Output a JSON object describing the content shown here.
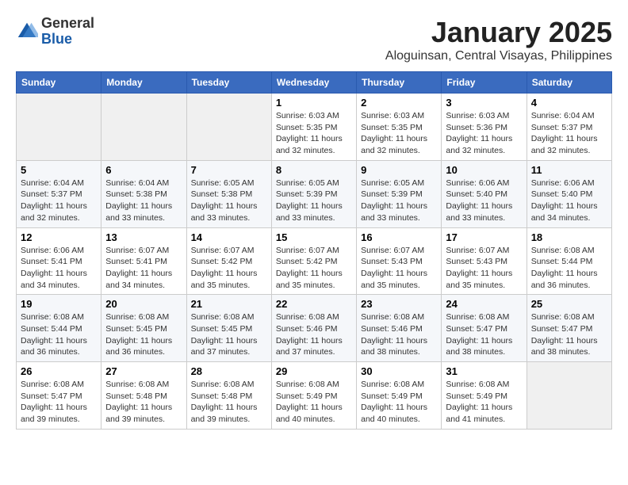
{
  "header": {
    "logo_general": "General",
    "logo_blue": "Blue",
    "month_title": "January 2025",
    "location": "Aloguinsan, Central Visayas, Philippines"
  },
  "weekdays": [
    "Sunday",
    "Monday",
    "Tuesday",
    "Wednesday",
    "Thursday",
    "Friday",
    "Saturday"
  ],
  "weeks": [
    [
      {
        "day": "",
        "info": ""
      },
      {
        "day": "",
        "info": ""
      },
      {
        "day": "",
        "info": ""
      },
      {
        "day": "1",
        "info": "Sunrise: 6:03 AM\nSunset: 5:35 PM\nDaylight: 11 hours and 32 minutes."
      },
      {
        "day": "2",
        "info": "Sunrise: 6:03 AM\nSunset: 5:35 PM\nDaylight: 11 hours and 32 minutes."
      },
      {
        "day": "3",
        "info": "Sunrise: 6:03 AM\nSunset: 5:36 PM\nDaylight: 11 hours and 32 minutes."
      },
      {
        "day": "4",
        "info": "Sunrise: 6:04 AM\nSunset: 5:37 PM\nDaylight: 11 hours and 32 minutes."
      }
    ],
    [
      {
        "day": "5",
        "info": "Sunrise: 6:04 AM\nSunset: 5:37 PM\nDaylight: 11 hours and 32 minutes."
      },
      {
        "day": "6",
        "info": "Sunrise: 6:04 AM\nSunset: 5:38 PM\nDaylight: 11 hours and 33 minutes."
      },
      {
        "day": "7",
        "info": "Sunrise: 6:05 AM\nSunset: 5:38 PM\nDaylight: 11 hours and 33 minutes."
      },
      {
        "day": "8",
        "info": "Sunrise: 6:05 AM\nSunset: 5:39 PM\nDaylight: 11 hours and 33 minutes."
      },
      {
        "day": "9",
        "info": "Sunrise: 6:05 AM\nSunset: 5:39 PM\nDaylight: 11 hours and 33 minutes."
      },
      {
        "day": "10",
        "info": "Sunrise: 6:06 AM\nSunset: 5:40 PM\nDaylight: 11 hours and 33 minutes."
      },
      {
        "day": "11",
        "info": "Sunrise: 6:06 AM\nSunset: 5:40 PM\nDaylight: 11 hours and 34 minutes."
      }
    ],
    [
      {
        "day": "12",
        "info": "Sunrise: 6:06 AM\nSunset: 5:41 PM\nDaylight: 11 hours and 34 minutes."
      },
      {
        "day": "13",
        "info": "Sunrise: 6:07 AM\nSunset: 5:41 PM\nDaylight: 11 hours and 34 minutes."
      },
      {
        "day": "14",
        "info": "Sunrise: 6:07 AM\nSunset: 5:42 PM\nDaylight: 11 hours and 35 minutes."
      },
      {
        "day": "15",
        "info": "Sunrise: 6:07 AM\nSunset: 5:42 PM\nDaylight: 11 hours and 35 minutes."
      },
      {
        "day": "16",
        "info": "Sunrise: 6:07 AM\nSunset: 5:43 PM\nDaylight: 11 hours and 35 minutes."
      },
      {
        "day": "17",
        "info": "Sunrise: 6:07 AM\nSunset: 5:43 PM\nDaylight: 11 hours and 35 minutes."
      },
      {
        "day": "18",
        "info": "Sunrise: 6:08 AM\nSunset: 5:44 PM\nDaylight: 11 hours and 36 minutes."
      }
    ],
    [
      {
        "day": "19",
        "info": "Sunrise: 6:08 AM\nSunset: 5:44 PM\nDaylight: 11 hours and 36 minutes."
      },
      {
        "day": "20",
        "info": "Sunrise: 6:08 AM\nSunset: 5:45 PM\nDaylight: 11 hours and 36 minutes."
      },
      {
        "day": "21",
        "info": "Sunrise: 6:08 AM\nSunset: 5:45 PM\nDaylight: 11 hours and 37 minutes."
      },
      {
        "day": "22",
        "info": "Sunrise: 6:08 AM\nSunset: 5:46 PM\nDaylight: 11 hours and 37 minutes."
      },
      {
        "day": "23",
        "info": "Sunrise: 6:08 AM\nSunset: 5:46 PM\nDaylight: 11 hours and 38 minutes."
      },
      {
        "day": "24",
        "info": "Sunrise: 6:08 AM\nSunset: 5:47 PM\nDaylight: 11 hours and 38 minutes."
      },
      {
        "day": "25",
        "info": "Sunrise: 6:08 AM\nSunset: 5:47 PM\nDaylight: 11 hours and 38 minutes."
      }
    ],
    [
      {
        "day": "26",
        "info": "Sunrise: 6:08 AM\nSunset: 5:47 PM\nDaylight: 11 hours and 39 minutes."
      },
      {
        "day": "27",
        "info": "Sunrise: 6:08 AM\nSunset: 5:48 PM\nDaylight: 11 hours and 39 minutes."
      },
      {
        "day": "28",
        "info": "Sunrise: 6:08 AM\nSunset: 5:48 PM\nDaylight: 11 hours and 39 minutes."
      },
      {
        "day": "29",
        "info": "Sunrise: 6:08 AM\nSunset: 5:49 PM\nDaylight: 11 hours and 40 minutes."
      },
      {
        "day": "30",
        "info": "Sunrise: 6:08 AM\nSunset: 5:49 PM\nDaylight: 11 hours and 40 minutes."
      },
      {
        "day": "31",
        "info": "Sunrise: 6:08 AM\nSunset: 5:49 PM\nDaylight: 11 hours and 41 minutes."
      },
      {
        "day": "",
        "info": ""
      }
    ]
  ]
}
